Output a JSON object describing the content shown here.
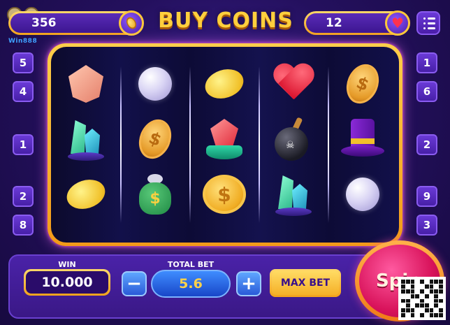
{
  "header": {
    "title": "BUY COINS",
    "coins_value": "356",
    "lives_value": "12",
    "logo_text": "Win888"
  },
  "paylines": {
    "left": [
      "5",
      "4",
      "1",
      "2",
      "8"
    ],
    "right": [
      "1",
      "6",
      "2",
      "9",
      "3"
    ]
  },
  "reels": [
    [
      "gem-peach",
      "crystal-green",
      "lemon"
    ],
    [
      "pearl",
      "coin",
      "money-bag"
    ],
    [
      "lemon",
      "ruby",
      "coin-flat"
    ],
    [
      "heart",
      "bomb",
      "crystal-green"
    ],
    [
      "coin",
      "top-hat",
      "pearl"
    ]
  ],
  "bottom_panel": {
    "win_label": "WIN",
    "win_value": "10.000",
    "total_bet_label": "TOTAL BET",
    "total_bet_value": "5.6",
    "minus_label": "−",
    "plus_label": "+",
    "max_bet_label": "MAX BET",
    "spin_label": "Spin"
  },
  "colors": {
    "accent_gold": "#ffcf3d",
    "frame_glow": "#ff78ff",
    "background": "#24105e",
    "spin_button": "#d8125a"
  }
}
